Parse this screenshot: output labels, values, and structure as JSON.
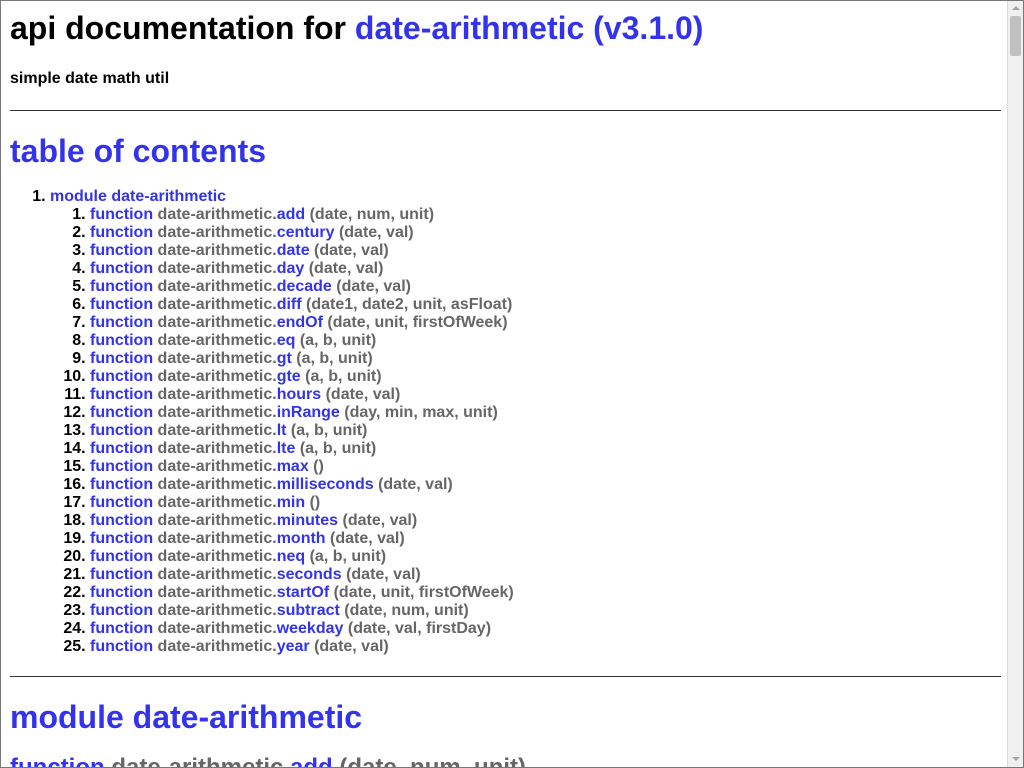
{
  "header": {
    "title_prefix": "api documentation for ",
    "package": "date-arithmetic (v3.1.0)",
    "description": "simple date math util"
  },
  "toc": {
    "title": "table of contents",
    "module_label": "module date-arithmetic",
    "keyword": "function",
    "namespace": "date-arithmetic.",
    "functions": [
      {
        "name": "add",
        "args": "(date, num, unit)"
      },
      {
        "name": "century",
        "args": "(date, val)"
      },
      {
        "name": "date",
        "args": "(date, val)"
      },
      {
        "name": "day",
        "args": "(date, val)"
      },
      {
        "name": "decade",
        "args": "(date, val)"
      },
      {
        "name": "diff",
        "args": "(date1, date2, unit, asFloat)"
      },
      {
        "name": "endOf",
        "args": "(date, unit, firstOfWeek)"
      },
      {
        "name": "eq",
        "args": "(a, b, unit)"
      },
      {
        "name": "gt",
        "args": "(a, b, unit)"
      },
      {
        "name": "gte",
        "args": "(a, b, unit)"
      },
      {
        "name": "hours",
        "args": "(date, val)"
      },
      {
        "name": "inRange",
        "args": "(day, min, max, unit)"
      },
      {
        "name": "lt",
        "args": "(a, b, unit)"
      },
      {
        "name": "lte",
        "args": "(a, b, unit)"
      },
      {
        "name": "max",
        "args": "()"
      },
      {
        "name": "milliseconds",
        "args": "(date, val)"
      },
      {
        "name": "min",
        "args": "()"
      },
      {
        "name": "minutes",
        "args": "(date, val)"
      },
      {
        "name": "month",
        "args": "(date, val)"
      },
      {
        "name": "neq",
        "args": "(a, b, unit)"
      },
      {
        "name": "seconds",
        "args": "(date, val)"
      },
      {
        "name": "startOf",
        "args": "(date, unit, firstOfWeek)"
      },
      {
        "name": "subtract",
        "args": "(date, num, unit)"
      },
      {
        "name": "weekday",
        "args": "(date, val, firstDay)"
      },
      {
        "name": "year",
        "args": "(date, val)"
      }
    ]
  },
  "module_section": {
    "title": "module date-arithmetic",
    "first_entry": {
      "keyword": "function",
      "namespace": "date-arithmetic.",
      "name": "add",
      "args": "(date, num, unit)"
    }
  },
  "colors": {
    "link": "#3333ee",
    "muted": "#666666",
    "text": "#000000"
  }
}
